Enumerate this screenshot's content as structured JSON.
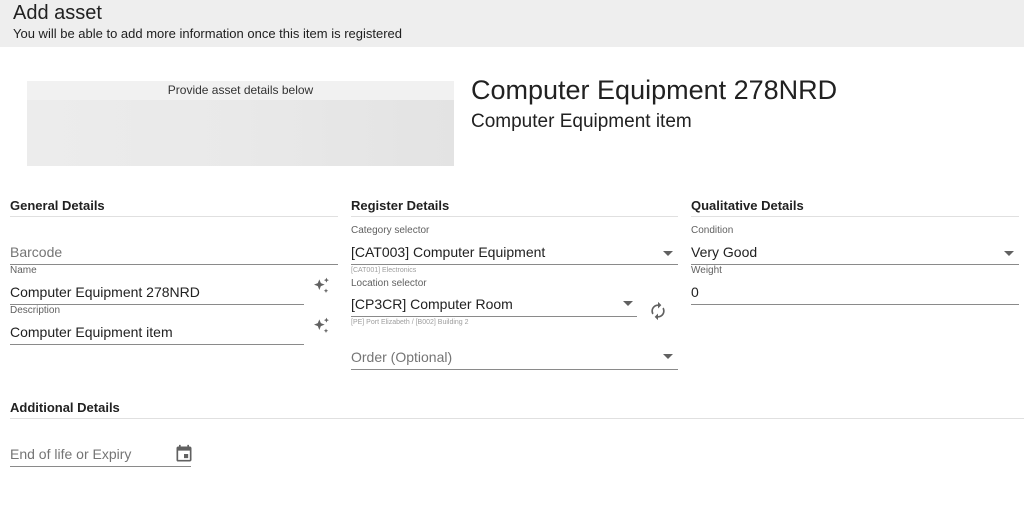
{
  "header": {
    "title": "Add asset",
    "subtitle": "You will be able to add more information once this item is registered"
  },
  "image_area": {
    "hint": "Provide asset details below"
  },
  "asset": {
    "name": "Computer Equipment 278NRD",
    "description": "Computer Equipment item"
  },
  "general": {
    "title": "General Details",
    "barcode": {
      "placeholder": "Barcode"
    },
    "name": {
      "label": "Name",
      "value": "Computer Equipment 278NRD",
      "icon": "sparkle-icon"
    },
    "description": {
      "label": "Description",
      "value": "Computer Equipment item",
      "icon": "sparkle-icon"
    }
  },
  "register": {
    "title": "Register Details",
    "category": {
      "label": "Category selector",
      "value": "[CAT003] Computer Equipment",
      "hint": "[CAT001] Electronics"
    },
    "location": {
      "label": "Location selector",
      "value": "[CP3CR] Computer Room",
      "hint": "[PE] Port Elizabeth / [B002] Building 2",
      "icon": "refresh-icon"
    },
    "order": {
      "placeholder": "Order (Optional)"
    }
  },
  "qualitative": {
    "title": "Qualitative Details",
    "condition": {
      "label": "Condition",
      "value": "Very Good"
    },
    "weight": {
      "label": "Weight",
      "value": "0"
    }
  },
  "additional": {
    "title": "Additional Details",
    "expiry": {
      "placeholder": "End of life or Expiry",
      "icon": "calendar-icon"
    }
  }
}
